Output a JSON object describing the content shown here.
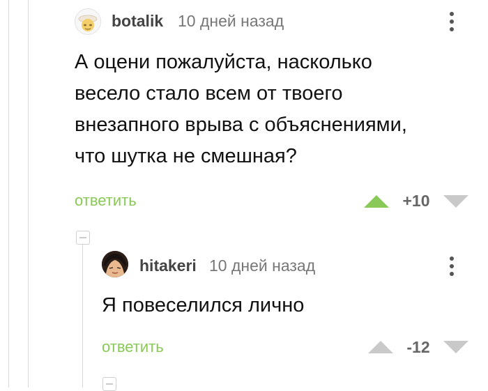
{
  "comments": [
    {
      "username": "botalik",
      "timestamp": "10 дней назад",
      "text_lines": [
        "А оцени пожалуйста, насколько",
        "весело стало всем от твоего",
        "внезапного врыва с объяснениями,",
        "что шутка не смешная?"
      ],
      "reply_label": "ответить",
      "rating": "+10",
      "colors": {
        "upvote": "#8ac858",
        "downvote": "#c9c9c9"
      }
    },
    {
      "username": "hitakeri",
      "timestamp": "10 дней назад",
      "text_lines": [
        "Я повеселился лично"
      ],
      "reply_label": "ответить",
      "rating": "-12",
      "colors": {
        "upvote": "#c9c9c9",
        "downvote": "#c9c9c9"
      }
    }
  ],
  "icons": {
    "menu": "more-vertical-icon",
    "upvote": "upvote-arrow-icon",
    "downvote": "downvote-arrow-icon",
    "collapse": "collapse-thread-icon"
  },
  "colors": {
    "accent": "#8ac858",
    "username": "#444444",
    "muted": "#777777",
    "thread_line": "#d9d9d9"
  }
}
